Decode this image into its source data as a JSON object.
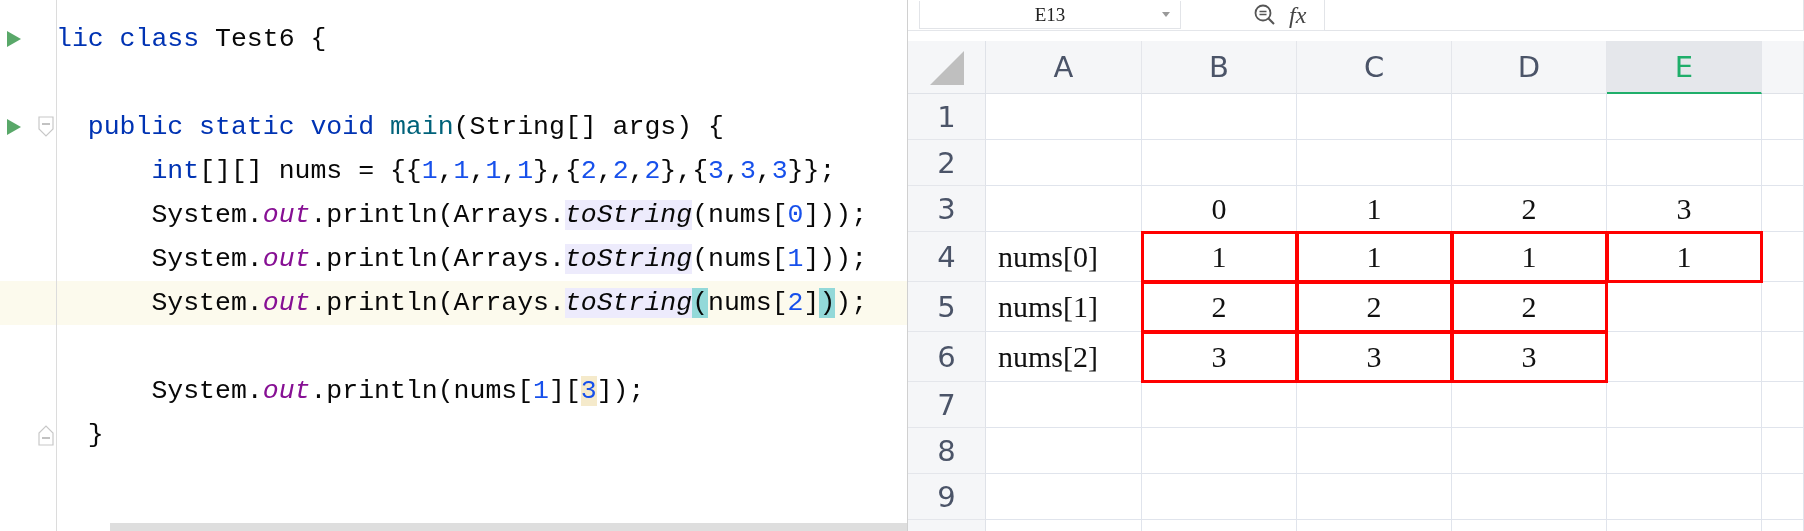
{
  "editor": {
    "lines": [
      {
        "current": false,
        "gutter": [
          {
            "kind": "run"
          }
        ],
        "tokens": [
          {
            "text": "lic class",
            "kind": "keyword"
          },
          {
            "text": " Test6 {",
            "kind": "plain"
          }
        ]
      },
      {
        "current": false
      },
      {
        "current": false,
        "gutter": [
          {
            "kind": "run"
          },
          {
            "kind": "fold_start"
          }
        ],
        "tokens": [
          {
            "text": "  public static void ",
            "kind": "keyword"
          },
          {
            "text": "main",
            "kind": "method"
          },
          {
            "text": "(String[] args) {",
            "kind": "plain"
          }
        ]
      },
      {
        "current": false,
        "tokens": [
          {
            "text": "      int",
            "kind": "keyword"
          },
          {
            "text": "[][] nums = {{",
            "kind": "plain"
          },
          {
            "text": "1",
            "kind": "number"
          },
          {
            "text": ",",
            "kind": "plain"
          },
          {
            "text": "1",
            "kind": "number"
          },
          {
            "text": ",",
            "kind": "plain"
          },
          {
            "text": "1",
            "kind": "number"
          },
          {
            "text": ",",
            "kind": "plain"
          },
          {
            "text": "1",
            "kind": "number"
          },
          {
            "text": "},{",
            "kind": "plain"
          },
          {
            "text": "2",
            "kind": "number"
          },
          {
            "text": ",",
            "kind": "plain"
          },
          {
            "text": "2",
            "kind": "number"
          },
          {
            "text": ",",
            "kind": "plain"
          },
          {
            "text": "2",
            "kind": "number"
          },
          {
            "text": "},{",
            "kind": "plain"
          },
          {
            "text": "3",
            "kind": "number"
          },
          {
            "text": ",",
            "kind": "plain"
          },
          {
            "text": "3",
            "kind": "number"
          },
          {
            "text": ",",
            "kind": "plain"
          },
          {
            "text": "3",
            "kind": "number"
          },
          {
            "text": "}};",
            "kind": "plain"
          }
        ]
      },
      {
        "current": false,
        "tokens": [
          {
            "text": "      System.",
            "kind": "plain"
          },
          {
            "text": "out",
            "kind": "field"
          },
          {
            "text": ".println(Arrays.",
            "kind": "plain"
          },
          {
            "text": "toString",
            "kind": "static",
            "color": "#edebfc"
          },
          {
            "text": "(nums[",
            "kind": "plain"
          },
          {
            "text": "0",
            "kind": "number"
          },
          {
            "text": "]));",
            "kind": "plain"
          }
        ]
      },
      {
        "current": false,
        "tokens": [
          {
            "text": "      System.",
            "kind": "plain"
          },
          {
            "text": "out",
            "kind": "field"
          },
          {
            "text": ".println(Arrays.",
            "kind": "plain"
          },
          {
            "text": "toString",
            "kind": "static",
            "color": "#edebfc"
          },
          {
            "text": "(nums[",
            "kind": "plain"
          },
          {
            "text": "1",
            "kind": "number"
          },
          {
            "text": "]));",
            "kind": "plain"
          }
        ]
      },
      {
        "current": true,
        "tokens": [
          {
            "text": "      System.",
            "kind": "plain"
          },
          {
            "text": "out",
            "kind": "field"
          },
          {
            "text": ".println(Arrays.",
            "kind": "plain"
          },
          {
            "text": "toString",
            "kind": "static",
            "color": "#edebfc"
          },
          {
            "text": "(",
            "kind": "plain",
            "color": "#93d9d9"
          },
          {
            "text": "nums[",
            "kind": "plain"
          },
          {
            "text": "2",
            "kind": "number"
          },
          {
            "text": "]",
            "kind": "plain"
          },
          {
            "text": ")",
            "kind": "plain",
            "color": "#93d9d9"
          },
          {
            "text": ");",
            "kind": "plain"
          }
        ]
      },
      {
        "current": false
      },
      {
        "current": false,
        "tokens": [
          {
            "text": "      System.",
            "kind": "plain"
          },
          {
            "text": "out",
            "kind": "field"
          },
          {
            "text": ".println(nums[",
            "kind": "plain"
          },
          {
            "text": "1",
            "kind": "number"
          },
          {
            "text": "][",
            "kind": "plain"
          },
          {
            "text": "3",
            "kind": "number",
            "color": "#f5eacb"
          },
          {
            "text": "]);",
            "kind": "plain"
          }
        ]
      },
      {
        "current": false,
        "gutter": [
          {
            "kind": "fold_end"
          }
        ],
        "tokens": [
          {
            "text": "  }",
            "kind": "plain"
          }
        ]
      }
    ]
  },
  "sheet": {
    "name_box": "E13",
    "formula_label": "fx",
    "columns": [
      {
        "label": "A",
        "selected": false
      },
      {
        "label": "B",
        "selected": false
      },
      {
        "label": "C",
        "selected": false
      },
      {
        "label": "D",
        "selected": false
      },
      {
        "label": "E",
        "selected": true
      }
    ],
    "rows": [
      {
        "label": "1"
      },
      {
        "label": "2"
      },
      {
        "label": "3",
        "cells": [
          {
            "bordered": false
          },
          {
            "text": "0",
            "bordered": false
          },
          {
            "text": "1",
            "bordered": false
          },
          {
            "text": "2",
            "bordered": false
          },
          {
            "text": "3",
            "bordered": false
          }
        ]
      },
      {
        "label": "4",
        "cells": [
          {
            "text": "nums[0]",
            "bordered": false
          },
          {
            "text": "1",
            "bordered": true
          },
          {
            "text": "1",
            "bordered": true
          },
          {
            "text": "1",
            "bordered": true
          },
          {
            "text": "1",
            "bordered": true
          }
        ]
      },
      {
        "label": "5",
        "cells": [
          {
            "text": "nums[1]",
            "bordered": false
          },
          {
            "text": "2",
            "bordered": true
          },
          {
            "text": "2",
            "bordered": true
          },
          {
            "text": "2",
            "bordered": true
          },
          {
            "bordered": false
          }
        ]
      },
      {
        "label": "6",
        "cells": [
          {
            "text": "nums[2]",
            "bordered": false
          },
          {
            "text": "3",
            "bordered": true
          },
          {
            "text": "3",
            "bordered": true
          },
          {
            "text": "3",
            "bordered": true
          },
          {
            "bordered": false
          }
        ]
      },
      {
        "label": "7"
      },
      {
        "label": "8"
      },
      {
        "label": "9"
      }
    ]
  }
}
